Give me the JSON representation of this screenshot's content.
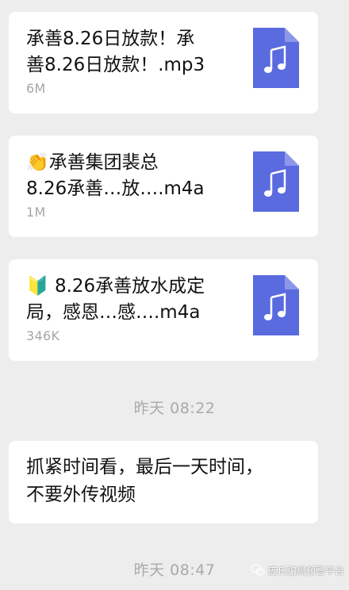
{
  "messages": [
    {
      "title": "承善8.26日放款！承\n善8.26日放款！.mp3",
      "size": "6M",
      "icon": "music-file-icon"
    },
    {
      "title": "👏承善集团裴总\n8.26承善…放….m4a",
      "size": "1M",
      "icon": "music-file-icon"
    },
    {
      "title": "🔰 8.26承善放水成定\n局，感恩…感….m4a",
      "size": "346K",
      "icon": "music-file-icon"
    }
  ],
  "time_separators": [
    "昨天 08:22",
    "昨天 08:47"
  ],
  "text_message": "抓紧时间看，最后一天时间，\n不要外传视频",
  "watermark": "庞氏骗局预警平台",
  "colors": {
    "background": "#ededed",
    "bubble": "#ffffff",
    "file_icon": "#5a6bdf",
    "time_text": "#a9a9a9",
    "size_text": "#a6a6a6"
  }
}
